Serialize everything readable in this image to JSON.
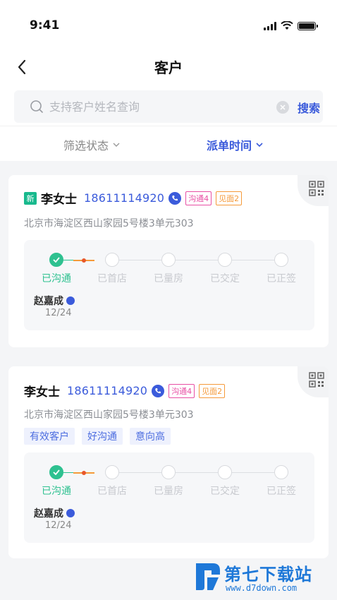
{
  "status": {
    "time": "9:41"
  },
  "nav": {
    "title": "客户"
  },
  "search": {
    "placeholder": "支持客户姓名查询",
    "value": "",
    "button": "搜索"
  },
  "filters": [
    {
      "label": "筛选状态"
    },
    {
      "label": "派单时间"
    }
  ],
  "steps": [
    "已沟通",
    "已首店",
    "已量房",
    "已交定",
    "已正签"
  ],
  "cards": [
    {
      "badge": "新",
      "name": "李女士",
      "phone": "18611114920",
      "tag_communicate": "沟通4",
      "tag_meet": "见面2",
      "address": "北京市海淀区西山家园5号楼3单元303",
      "labels": [],
      "agent": "赵嘉成",
      "date": "12/24"
    },
    {
      "name": "李女士",
      "phone": "18611114920",
      "tag_communicate": "沟通4",
      "tag_meet": "见面2",
      "address": "北京市海淀区西山家园5号楼3单元303",
      "labels": [
        "有效客户",
        "好沟通",
        "意向高"
      ],
      "agent": "赵嘉成",
      "date": "12/24"
    }
  ],
  "watermark": {
    "title": "第七下载站",
    "url": "www.d7down.com"
  },
  "colors": {
    "accent": "#3b5bdb",
    "green": "#2ec190",
    "pink": "#e84fa4",
    "orange": "#f59a3a"
  }
}
